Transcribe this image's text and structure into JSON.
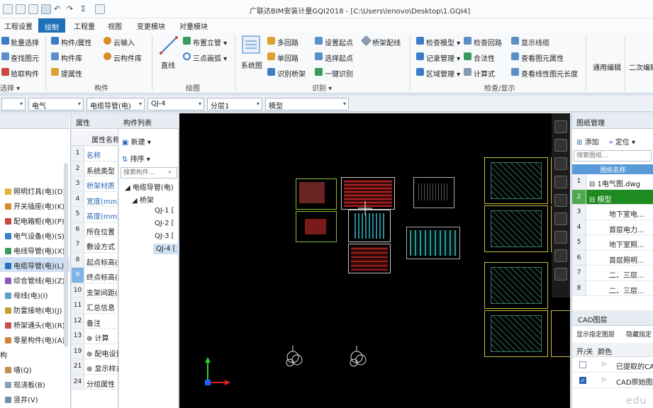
{
  "title": "广联达BIM安装计量GQI2018 - [C:\\Users\\lenovo\\Desktop\\1.GQI4]",
  "menu": [
    "工程设置",
    "绘制",
    "工程量",
    "视图",
    "变更模块",
    "对量模块"
  ],
  "ribbon": {
    "select": {
      "b1": "批量选择",
      "b2": "查找图元",
      "b3": "拾取构件",
      "label": "选择 ▾"
    },
    "component": {
      "b1": "构件/属性",
      "b2": "构件库",
      "b3": "提属性",
      "b4": "云输入",
      "b5": "云构件库",
      "label": "构件"
    },
    "draw": {
      "line": "直线",
      "b1": "布置立管 ▾",
      "b2": "三点画弧 ▾",
      "label": "绘图"
    },
    "identify": {
      "system": "系统图",
      "b1": "多回路",
      "b2": "单回路",
      "b3": "识别桥架",
      "b4": "设置起点",
      "b5": "选择起点",
      "b6": "一键识别",
      "b7": "桥架配线",
      "label": "识别 ▾"
    },
    "check": {
      "b1": "检查模型 ▾",
      "b2": "记录管理 ▾",
      "b3": "区域管理 ▾",
      "b4": "检查回路",
      "b5": "合法性",
      "b6": "计算式",
      "b7": "显示线缆",
      "b8": "查看图元属性",
      "b9": "查看线性图元长度",
      "label": "检查/显示"
    },
    "general": {
      "b1": "通用编辑",
      "b2": "二次编辑"
    }
  },
  "propbar": [
    "电气",
    "电缆导管(电)",
    "QJ-4",
    "分层1",
    "模型"
  ],
  "left_tree": [
    {
      "label": "照明灯具(电)(D)",
      "color": "#e3b43a"
    },
    {
      "label": "开关插座(电)(K)",
      "color": "#d98a2b"
    },
    {
      "label": "配电箱柜(电)(P)",
      "color": "#c84a3a"
    },
    {
      "label": "电气设备(电)(S)",
      "color": "#3a7ec8"
    },
    {
      "label": "电线导管(电)(X)",
      "color": "#3a9a5a"
    },
    {
      "label": "电缆导管(电)(L)",
      "color": "#2c6fbf"
    },
    {
      "label": "综合管线(电)(Z)",
      "color": "#8a5ac0"
    },
    {
      "label": "母线(电)(I)",
      "color": "#5aa0c8"
    },
    {
      "label": "防雷接地(电)(J)",
      "color": "#c0a030"
    },
    {
      "label": "桥架通头(电)(R)",
      "color": "#c85050"
    },
    {
      "label": "零星构件(电)(A)",
      "color": "#d0843a"
    },
    {
      "label": "构",
      "color": ""
    },
    {
      "label": "墙(Q)",
      "color": "#c09050"
    },
    {
      "label": "现浇板(B)",
      "color": "#8aa0b8"
    },
    {
      "label": "竖井(V)",
      "color": "#7090a8"
    }
  ],
  "property_panel": {
    "tab": "属性",
    "header": "属性名称",
    "rows": [
      {
        "num": "1",
        "name": "名称",
        "blue": true
      },
      {
        "num": "2",
        "name": "系统类型",
        "blue": false
      },
      {
        "num": "3",
        "name": "桥架材质",
        "blue": true
      },
      {
        "num": "4",
        "name": "宽度(mm)",
        "blue": true
      },
      {
        "num": "5",
        "name": "高度(mm)",
        "blue": true
      },
      {
        "num": "6",
        "name": "所在位置",
        "blue": false
      },
      {
        "num": "7",
        "name": "敷设方式",
        "blue": false
      },
      {
        "num": "8",
        "name": "起点标高(m)",
        "blue": false
      },
      {
        "num": "9",
        "name": "终点标高(m)",
        "blue": false
      },
      {
        "num": "10",
        "name": "支架间距(mm)",
        "blue": false
      },
      {
        "num": "11",
        "name": "汇总信息",
        "blue": false
      },
      {
        "num": "12",
        "name": "备注",
        "blue": false
      },
      {
        "num": "13",
        "name": "⊕ 计算",
        "blue": false
      },
      {
        "num": "19",
        "name": "⊕ 配电设置",
        "blue": false
      },
      {
        "num": "21",
        "name": "⊕ 显示样式",
        "blue": false
      },
      {
        "num": "24",
        "name": "分组属性",
        "blue": false
      }
    ]
  },
  "component_list": {
    "tab": "构件列表",
    "new": "新建 ▾",
    "sort": "排序 ▾",
    "search_placeholder": "搜索构件...",
    "root": "◢ 电缆导管(电)",
    "group": "◢ 桥架",
    "items": [
      "QJ-1 [",
      "QJ-2 [",
      "QJ-3 [",
      "QJ-4 ["
    ]
  },
  "drawing_panel": {
    "title": "图纸管理",
    "add": "添加",
    "locate": "定位 ▾",
    "search_placeholder": "搜索图纸...",
    "header": "图纸名称",
    "rows": [
      {
        "num": "1",
        "name": "⊟ 1电气图.dwg",
        "green": false
      },
      {
        "num": "2",
        "name": "⊟ 模型",
        "green": true
      },
      {
        "num": "3",
        "name": "地下室电...",
        "green": false
      },
      {
        "num": "4",
        "name": "首层电力...",
        "green": false
      },
      {
        "num": "5",
        "name": "地下室照...",
        "green": false
      },
      {
        "num": "6",
        "name": "首层照明...",
        "green": false
      },
      {
        "num": "7",
        "name": "二、三层...",
        "green": false
      },
      {
        "num": "8",
        "name": "二、三层...",
        "green": false
      }
    ]
  },
  "cad_layers": {
    "title": "CAD图层",
    "show_specified": "显示指定图层",
    "hide_specified": "隐藏指定",
    "col_toggle": "开/关",
    "col_color": "颜色",
    "rows": [
      {
        "name": "已提取的CAD图层",
        "checked": false
      },
      {
        "name": "CAD原始图层",
        "checked": true
      }
    ]
  },
  "watermark": "edu"
}
